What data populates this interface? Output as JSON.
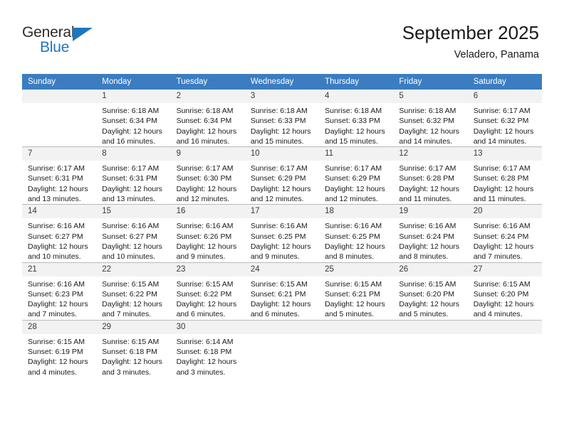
{
  "brand": {
    "name_part1": "General",
    "name_part2": "Blue",
    "accent_color": "#1f76bc"
  },
  "header": {
    "title": "September 2025",
    "subtitle": "Veladero, Panama",
    "header_bg_color": "#3b7dc0",
    "daynum_bg_color": "#f2f2f2"
  },
  "weekday_headers": [
    "Sunday",
    "Monday",
    "Tuesday",
    "Wednesday",
    "Thursday",
    "Friday",
    "Saturday"
  ],
  "weeks": [
    [
      {
        "day": "",
        "lines": []
      },
      {
        "day": "1",
        "lines": [
          "Sunrise: 6:18 AM",
          "Sunset: 6:34 PM",
          "Daylight: 12 hours",
          "and 16 minutes."
        ]
      },
      {
        "day": "2",
        "lines": [
          "Sunrise: 6:18 AM",
          "Sunset: 6:34 PM",
          "Daylight: 12 hours",
          "and 16 minutes."
        ]
      },
      {
        "day": "3",
        "lines": [
          "Sunrise: 6:18 AM",
          "Sunset: 6:33 PM",
          "Daylight: 12 hours",
          "and 15 minutes."
        ]
      },
      {
        "day": "4",
        "lines": [
          "Sunrise: 6:18 AM",
          "Sunset: 6:33 PM",
          "Daylight: 12 hours",
          "and 15 minutes."
        ]
      },
      {
        "day": "5",
        "lines": [
          "Sunrise: 6:18 AM",
          "Sunset: 6:32 PM",
          "Daylight: 12 hours",
          "and 14 minutes."
        ]
      },
      {
        "day": "6",
        "lines": [
          "Sunrise: 6:17 AM",
          "Sunset: 6:32 PM",
          "Daylight: 12 hours",
          "and 14 minutes."
        ]
      }
    ],
    [
      {
        "day": "7",
        "lines": [
          "Sunrise: 6:17 AM",
          "Sunset: 6:31 PM",
          "Daylight: 12 hours",
          "and 13 minutes."
        ]
      },
      {
        "day": "8",
        "lines": [
          "Sunrise: 6:17 AM",
          "Sunset: 6:31 PM",
          "Daylight: 12 hours",
          "and 13 minutes."
        ]
      },
      {
        "day": "9",
        "lines": [
          "Sunrise: 6:17 AM",
          "Sunset: 6:30 PM",
          "Daylight: 12 hours",
          "and 12 minutes."
        ]
      },
      {
        "day": "10",
        "lines": [
          "Sunrise: 6:17 AM",
          "Sunset: 6:29 PM",
          "Daylight: 12 hours",
          "and 12 minutes."
        ]
      },
      {
        "day": "11",
        "lines": [
          "Sunrise: 6:17 AM",
          "Sunset: 6:29 PM",
          "Daylight: 12 hours",
          "and 12 minutes."
        ]
      },
      {
        "day": "12",
        "lines": [
          "Sunrise: 6:17 AM",
          "Sunset: 6:28 PM",
          "Daylight: 12 hours",
          "and 11 minutes."
        ]
      },
      {
        "day": "13",
        "lines": [
          "Sunrise: 6:17 AM",
          "Sunset: 6:28 PM",
          "Daylight: 12 hours",
          "and 11 minutes."
        ]
      }
    ],
    [
      {
        "day": "14",
        "lines": [
          "Sunrise: 6:16 AM",
          "Sunset: 6:27 PM",
          "Daylight: 12 hours",
          "and 10 minutes."
        ]
      },
      {
        "day": "15",
        "lines": [
          "Sunrise: 6:16 AM",
          "Sunset: 6:27 PM",
          "Daylight: 12 hours",
          "and 10 minutes."
        ]
      },
      {
        "day": "16",
        "lines": [
          "Sunrise: 6:16 AM",
          "Sunset: 6:26 PM",
          "Daylight: 12 hours",
          "and 9 minutes."
        ]
      },
      {
        "day": "17",
        "lines": [
          "Sunrise: 6:16 AM",
          "Sunset: 6:25 PM",
          "Daylight: 12 hours",
          "and 9 minutes."
        ]
      },
      {
        "day": "18",
        "lines": [
          "Sunrise: 6:16 AM",
          "Sunset: 6:25 PM",
          "Daylight: 12 hours",
          "and 8 minutes."
        ]
      },
      {
        "day": "19",
        "lines": [
          "Sunrise: 6:16 AM",
          "Sunset: 6:24 PM",
          "Daylight: 12 hours",
          "and 8 minutes."
        ]
      },
      {
        "day": "20",
        "lines": [
          "Sunrise: 6:16 AM",
          "Sunset: 6:24 PM",
          "Daylight: 12 hours",
          "and 7 minutes."
        ]
      }
    ],
    [
      {
        "day": "21",
        "lines": [
          "Sunrise: 6:16 AM",
          "Sunset: 6:23 PM",
          "Daylight: 12 hours",
          "and 7 minutes."
        ]
      },
      {
        "day": "22",
        "lines": [
          "Sunrise: 6:15 AM",
          "Sunset: 6:22 PM",
          "Daylight: 12 hours",
          "and 7 minutes."
        ]
      },
      {
        "day": "23",
        "lines": [
          "Sunrise: 6:15 AM",
          "Sunset: 6:22 PM",
          "Daylight: 12 hours",
          "and 6 minutes."
        ]
      },
      {
        "day": "24",
        "lines": [
          "Sunrise: 6:15 AM",
          "Sunset: 6:21 PM",
          "Daylight: 12 hours",
          "and 6 minutes."
        ]
      },
      {
        "day": "25",
        "lines": [
          "Sunrise: 6:15 AM",
          "Sunset: 6:21 PM",
          "Daylight: 12 hours",
          "and 5 minutes."
        ]
      },
      {
        "day": "26",
        "lines": [
          "Sunrise: 6:15 AM",
          "Sunset: 6:20 PM",
          "Daylight: 12 hours",
          "and 5 minutes."
        ]
      },
      {
        "day": "27",
        "lines": [
          "Sunrise: 6:15 AM",
          "Sunset: 6:20 PM",
          "Daylight: 12 hours",
          "and 4 minutes."
        ]
      }
    ],
    [
      {
        "day": "28",
        "lines": [
          "Sunrise: 6:15 AM",
          "Sunset: 6:19 PM",
          "Daylight: 12 hours",
          "and 4 minutes."
        ]
      },
      {
        "day": "29",
        "lines": [
          "Sunrise: 6:15 AM",
          "Sunset: 6:18 PM",
          "Daylight: 12 hours",
          "and 3 minutes."
        ]
      },
      {
        "day": "30",
        "lines": [
          "Sunrise: 6:14 AM",
          "Sunset: 6:18 PM",
          "Daylight: 12 hours",
          "and 3 minutes."
        ]
      },
      {
        "day": "",
        "lines": []
      },
      {
        "day": "",
        "lines": []
      },
      {
        "day": "",
        "lines": []
      },
      {
        "day": "",
        "lines": []
      }
    ]
  ]
}
